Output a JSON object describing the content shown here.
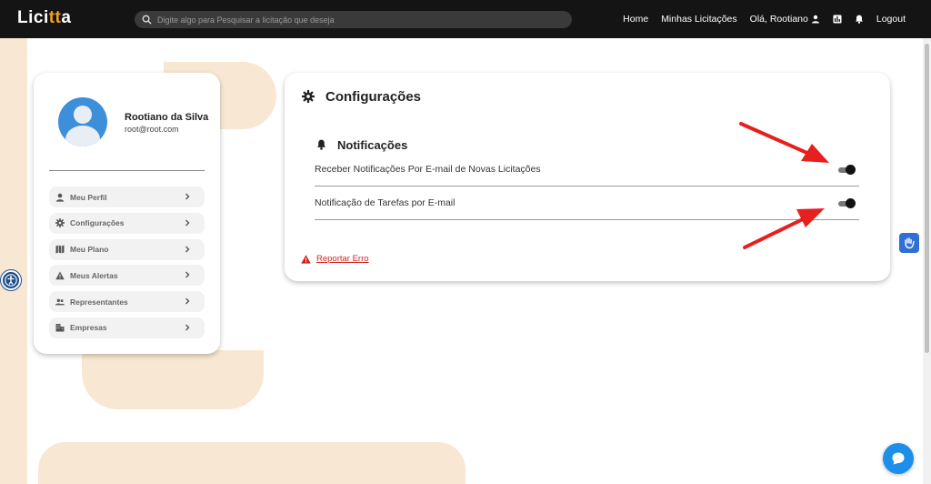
{
  "app": {
    "logo_main": "Lici",
    "logo_accent": "tt",
    "logo_end": "a"
  },
  "search": {
    "placeholder": "Digite algo para Pesquisar a licitação que deseja"
  },
  "nav": {
    "home": "Home",
    "minhas_licitacoes": "Minhas Licitações",
    "greeting": "Olá, Rootiano",
    "logout": "Logout"
  },
  "profile": {
    "name": "Rootiano da Silva",
    "email": "root@root.com"
  },
  "menu": {
    "items": [
      {
        "label": "Meu Perfil",
        "icon": "person-icon"
      },
      {
        "label": "Configurações",
        "icon": "gear-icon"
      },
      {
        "label": "Meu Plano",
        "icon": "map-icon"
      },
      {
        "label": "Meus Alertas",
        "icon": "warning-icon"
      },
      {
        "label": "Representantes",
        "icon": "people-icon"
      },
      {
        "label": "Empresas",
        "icon": "building-icon"
      }
    ]
  },
  "settings": {
    "title": "Configurações",
    "notifications_title": "Notificações",
    "options": [
      {
        "label": "Receber Notificações Por E-mail de Novas Licitações",
        "enabled": true
      },
      {
        "label": "Notificação de Tarefas por E-mail",
        "enabled": true
      }
    ],
    "report_label": "Reportar Erro"
  },
  "colors": {
    "topbar": "#141414",
    "accent_logo": "#f0a020",
    "background_shape": "#f8e7d2",
    "annotation_arrow": "#e81f1f",
    "report": "#d42424",
    "chat_button": "#1e8fe8"
  }
}
